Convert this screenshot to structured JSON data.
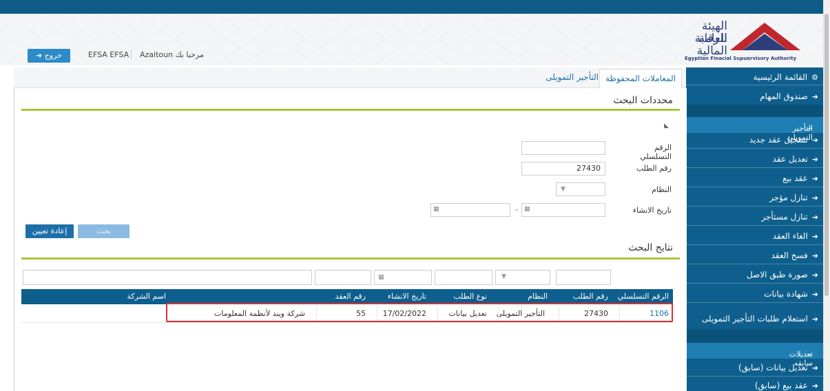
{
  "header": {
    "logo_arabic_line1": "الهيئة العامة",
    "logo_arabic_line2": "للرقابة المالية",
    "logo_english": "Egyptian Finacial Supuervisory Authority",
    "logout_label": "خروج",
    "logout_icon": "sign-out-icon",
    "user_name": "EFSA EFSA",
    "welcome_text": "مرحبا بك Azaitoun"
  },
  "sidebar": {
    "main_menu": "القائمة الرئيسية",
    "main_menu_icon": "cogs-icon",
    "task_box": "صندوق المهام",
    "group1_title": "التأجير التمويلى",
    "group1_items": [
      "تسجيل عقد جديد",
      "تعديل عقد",
      "عقد بيع",
      "تنازل مؤجر",
      "تنازل مستأجر",
      "الغاء العقد",
      "فسخ العقد",
      "صورة طبق الاصل",
      "شهادة بيانات",
      "استعلام طلبات التأجير التمويلى"
    ],
    "group2_title": "تعديلات سابقه",
    "group2_items": [
      "تعديل بيانات (سابق)",
      "عقد بيع (سابق)"
    ]
  },
  "tabs": {
    "active": "المعاملات المحفوظة",
    "other": "التأجير التمويلى"
  },
  "search": {
    "title": "محددات البحث",
    "serial_label": "الرقم التسلسلي",
    "serial_value": "",
    "request_label": "رقم الطلب",
    "request_value": "27430",
    "system_label": "النظام",
    "system_value": "",
    "created_label": "تاريخ الانشاء",
    "date_separator": "-",
    "search_button": "بحث",
    "reset_button": "إعادة تعيين"
  },
  "results": {
    "title": "نتايج البحث",
    "columns": {
      "serial": "الرقم التسلسلي",
      "request": "رقم الطلب",
      "system": "النظام",
      "type": "نوع الطلب",
      "created": "تاريخ الانشاء",
      "contract": "رقم العقد",
      "company": "اسم الشركة"
    },
    "row": {
      "serial": "1106",
      "request": "27430",
      "system": "التأجير التمويلى",
      "type": "تعديل بيانات",
      "created": "17/02/2022",
      "contract": "55",
      "company": "شركة ويند لأنظمة المعلومات"
    }
  },
  "colors": {
    "primary": "#0e5f8d",
    "accent_line": "#a8c636",
    "highlight": "#d9302f"
  }
}
